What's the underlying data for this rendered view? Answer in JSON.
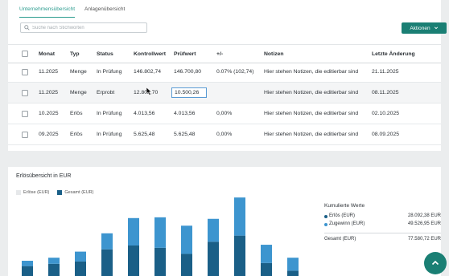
{
  "tabs": [
    {
      "label": "Unternehmensübersicht",
      "active": true
    },
    {
      "label": "Anlagenübersicht",
      "active": false
    }
  ],
  "search": {
    "placeholder": "Suche nach Stichworten"
  },
  "actions": {
    "label": "Aktionen"
  },
  "table": {
    "columns": [
      "Monat",
      "Typ",
      "Status",
      "Kontrollwert",
      "Prüfwert",
      "+/-",
      "Notizen",
      "Letzte Änderung"
    ],
    "rows": [
      {
        "monat": "11.2025",
        "typ": "Menge",
        "status": "In Prüfung",
        "kontroll": "146.802,74",
        "pruef": "146.700,80",
        "pm": "0.07% (102,74)",
        "notiz": "Hier stehen Notizen, die editierbar sind",
        "last": "21.11.2025"
      },
      {
        "monat": "11.2025",
        "typ": "Menge",
        "status": "Erprobt",
        "kontroll": "12.802,70",
        "pruef": "10.500,26",
        "pm": "",
        "notiz": "Hier stehen Notizen, die editierbar sind",
        "last": "08.11.2025"
      },
      {
        "monat": "10.2025",
        "typ": "Erlös",
        "status": "In Prüfung",
        "kontroll": "4.013,56",
        "pruef": "4.013,56",
        "pm": "0,00%",
        "notiz": "Hier stehen Notizen, die editierbar sind",
        "last": "02.10.2025"
      },
      {
        "monat": "09.2025",
        "typ": "Erlös",
        "status": "In Prüfung",
        "kontroll": "5.625,48",
        "pruef": "5.625,48",
        "pm": "0,00%",
        "notiz": "Hier stehen Notizen, die editierbar sind",
        "last": "08.09.2025"
      }
    ]
  },
  "chart": {
    "title": "Erlösübersicht in EUR"
  },
  "chart_data": {
    "type": "bar",
    "series": [
      {
        "name": "Erlöse (EUR)",
        "color": "#1a5f87",
        "values": [
          13,
          16,
          19,
          35,
          40,
          37,
          29,
          45,
          53,
          17,
          7
        ]
      },
      {
        "name": "Gesamt (EUR)",
        "color": "#3d95cf",
        "values": [
          7,
          8,
          13,
          21,
          36,
          40,
          37,
          30,
          50,
          24,
          17
        ]
      }
    ],
    "legend": "top-left",
    "grid": false
  },
  "kumulierte": {
    "title": "Kumulierte Werte",
    "items": [
      {
        "label": "Erlös (EUR)",
        "value": "28.092,38 EUR",
        "color": "#1a5f87"
      },
      {
        "label": "Zugewinn (EUR)",
        "value": "49.526,95 EUR",
        "color": "#3d95cf"
      }
    ],
    "total_label": "Gesamt (EUR)",
    "total_value": "77.580,72 EUR"
  },
  "icons": {
    "search": "search-icon",
    "chevron": "chevron-down-icon",
    "fab": "arrow-up-icon",
    "cursor": "cursor-icon"
  }
}
